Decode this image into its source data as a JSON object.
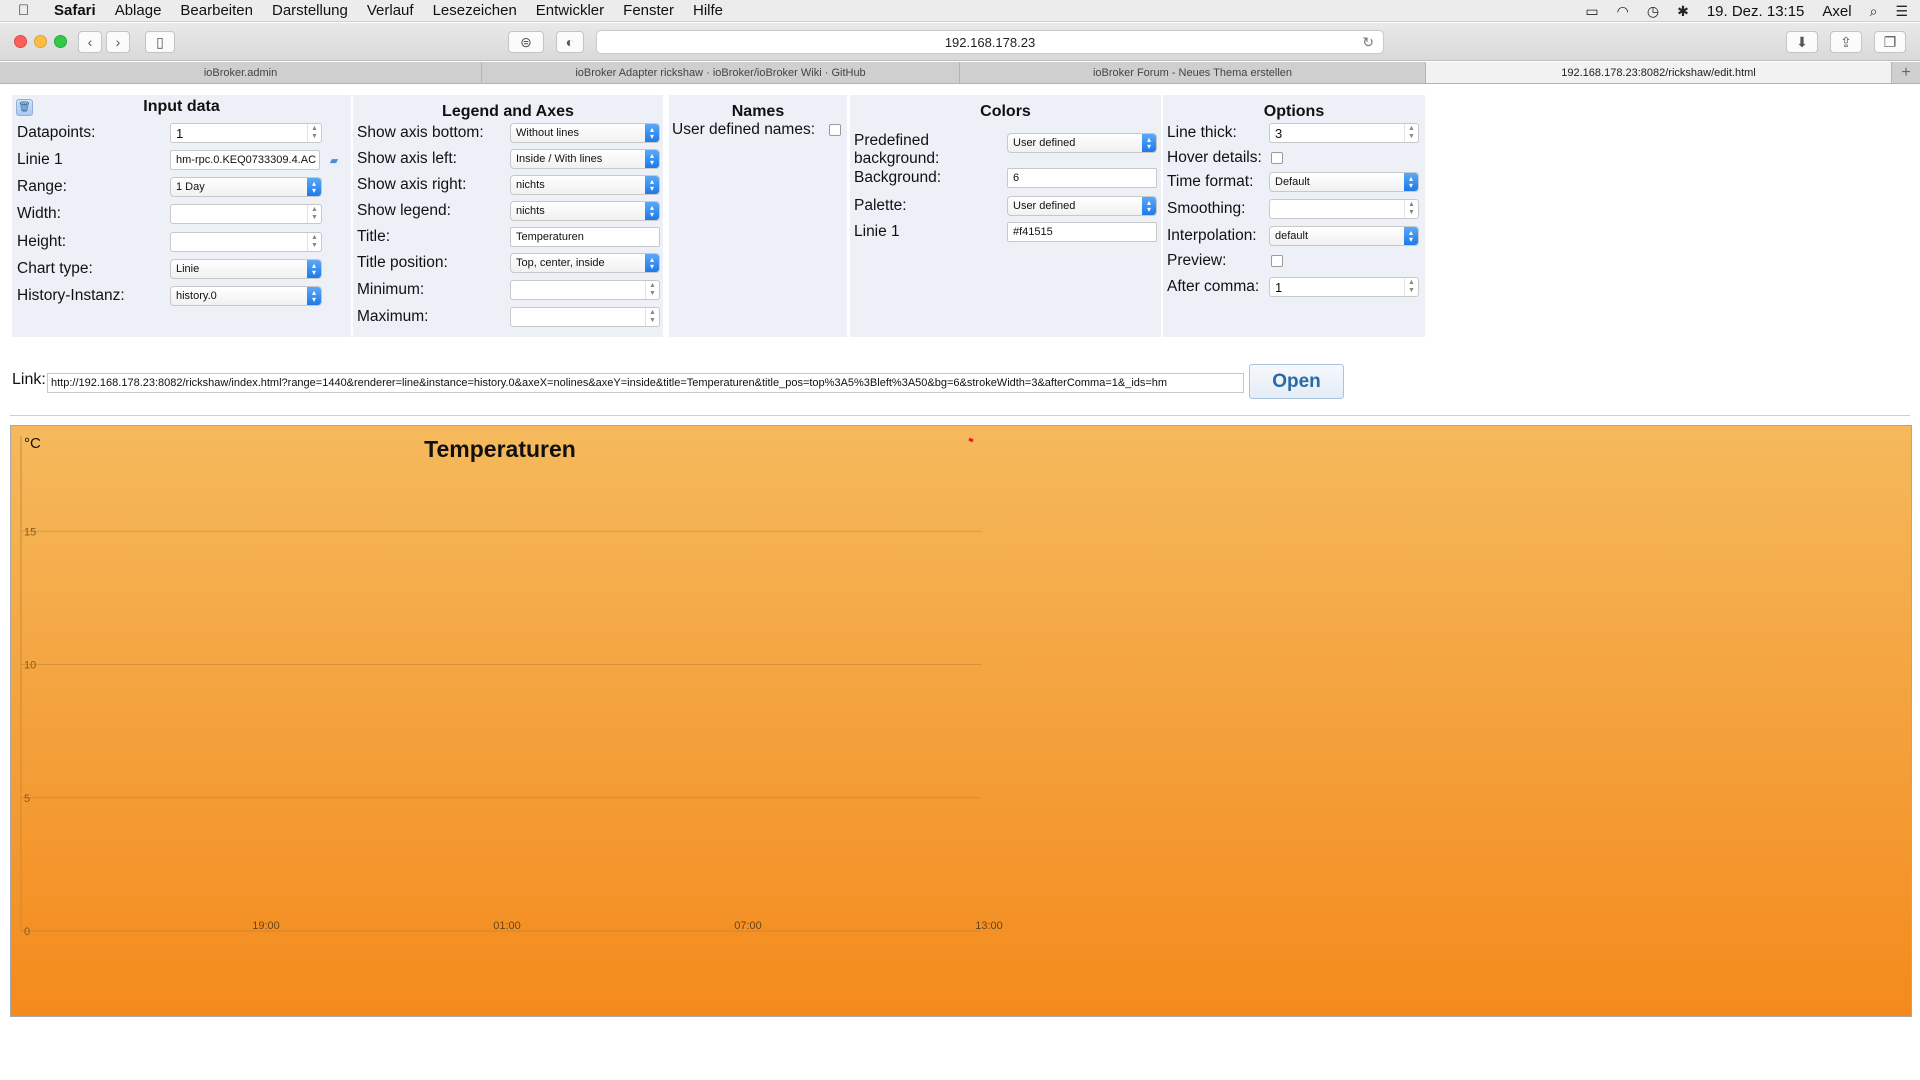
{
  "menubar": {
    "app": "Safari",
    "items": [
      "Ablage",
      "Bearbeiten",
      "Darstellung",
      "Verlauf",
      "Lesezeichen",
      "Entwickler",
      "Fenster",
      "Hilfe"
    ],
    "datetime": "19. Dez.  13:15",
    "user": "Axel",
    "icons": [
      "apple-icon",
      "airplay-icon",
      "wifi-icon",
      "time-machine-icon",
      "bluetooth-icon",
      "spotlight-icon",
      "notification-center-icon"
    ]
  },
  "toolbar": {
    "address": "192.168.178.23"
  },
  "tabs": [
    {
      "label": "ioBroker.admin",
      "active": false
    },
    {
      "label": "ioBroker Adapter rickshaw · ioBroker/ioBroker Wiki · GitHub",
      "active": false
    },
    {
      "label": "ioBroker Forum - Neues Thema erstellen",
      "active": false
    },
    {
      "label": "192.168.178.23:8082/rickshaw/edit.html",
      "active": true
    }
  ],
  "input_data": {
    "heading": "Input data",
    "datapoints_label": "Datapoints:",
    "datapoints_value": "1",
    "linie1_label": "Linie 1",
    "linie1_value": "hm-rpc.0.KEQ0733309.4.AC",
    "range_label": "Range:",
    "range_value": "1 Day",
    "width_label": "Width:",
    "width_value": "",
    "height_label": "Height:",
    "height_value": "",
    "charttype_label": "Chart type:",
    "charttype_value": "Linie",
    "history_label": "History-Instanz:",
    "history_value": "history.0"
  },
  "legend_axes": {
    "heading": "Legend and Axes",
    "axis_bottom_label": "Show axis bottom:",
    "axis_bottom_value": "Without lines",
    "axis_left_label": "Show axis left:",
    "axis_left_value": "Inside / With lines",
    "axis_right_label": "Show axis right:",
    "axis_right_value": "nichts",
    "legend_label": "Show legend:",
    "legend_value": "nichts",
    "title_label": "Title:",
    "title_value": "Temperaturen",
    "title_pos_label": "Title position:",
    "title_pos_value": "Top, center, inside",
    "minimum_label": "Minimum:",
    "minimum_value": "",
    "maximum_label": "Maximum:",
    "maximum_value": ""
  },
  "names": {
    "heading": "Names",
    "user_defined_label": "User defined names:"
  },
  "colors": {
    "heading": "Colors",
    "predefined_label_1": "Predefined",
    "predefined_label_2": "background:",
    "predefined_value": "User defined",
    "background_label": "Background:",
    "background_value": "6",
    "palette_label": "Palette:",
    "palette_value": "User defined",
    "linie1_label": "Linie 1",
    "linie1_value": "#f41515"
  },
  "options": {
    "heading": "Options",
    "line_thick_label": "Line thick:",
    "line_thick_value": "3",
    "hover_label": "Hover details:",
    "time_format_label": "Time format:",
    "time_format_value": "Default",
    "smoothing_label": "Smoothing:",
    "smoothing_value": "",
    "interpolation_label": "Interpolation:",
    "interpolation_value": "default",
    "preview_label": "Preview:",
    "after_comma_label": "After comma:",
    "after_comma_value": "1"
  },
  "link": {
    "label": "Link:",
    "value": "http://192.168.178.23:8082/rickshaw/index.html?range=1440&renderer=line&instance=history.0&axeX=nolines&axeY=inside&title=Temperaturen&title_pos=top%3A5%3Bleft%3A50&bg=6&strokeWidth=3&afterComma=1&_ids=hm",
    "open_label": "Open"
  },
  "chart_data": {
    "type": "line",
    "title": "Temperaturen",
    "ylabel": "°C",
    "yticks": [
      "15",
      "10",
      "5",
      "0"
    ],
    "ylim": [
      0,
      15
    ],
    "xticks": [
      "19:00",
      "01:00",
      "07:00",
      "13:00"
    ],
    "series": [
      {
        "color": "#f41515",
        "values": []
      }
    ],
    "grid": true,
    "background": [
      "#f5b95c",
      "#f48a1c"
    ]
  }
}
